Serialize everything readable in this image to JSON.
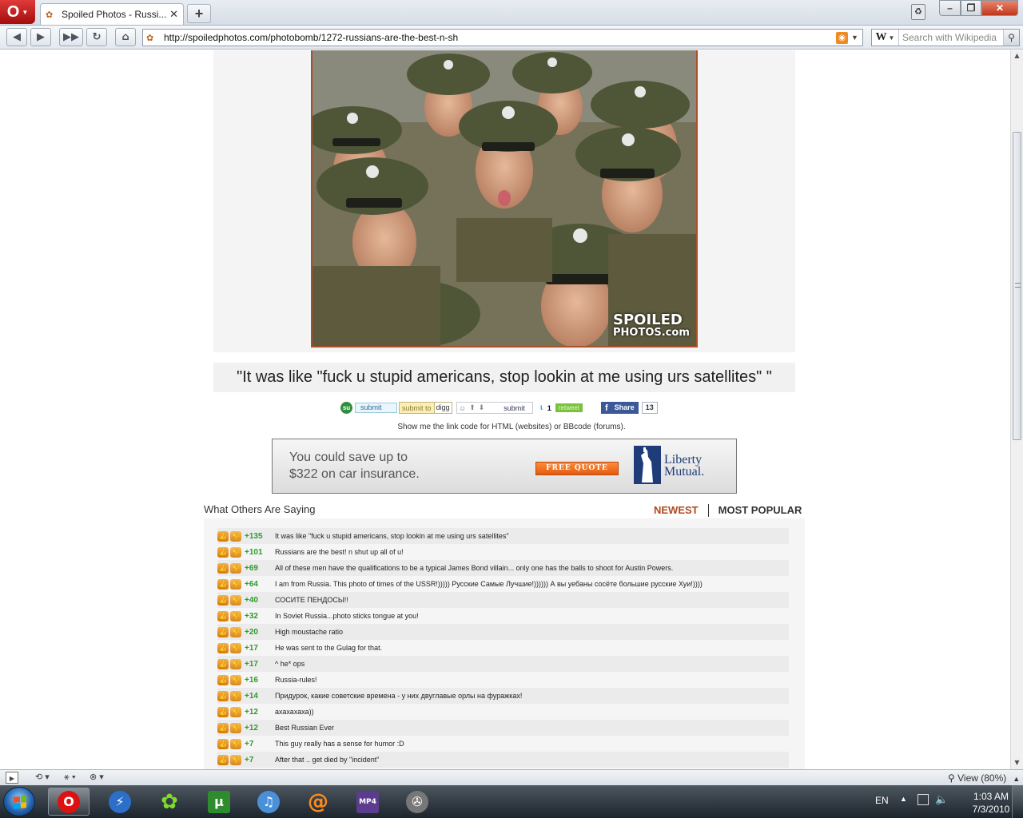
{
  "browser": {
    "tab_title": "Spoiled Photos - Russi...",
    "url": "http://spoiledphotos.com/photobomb/1272-russians-are-the-best-n-sh",
    "search_placeholder": "Search with Wikipedia",
    "search_engine_letter": "W",
    "opera_letter": "O",
    "zoom_label": "View (80%)"
  },
  "photo": {
    "watermark_line1": "SPOILED",
    "watermark_line2": "PHOTOS.com"
  },
  "caption": "\"It was like \"fuck u stupid americans, stop lookin at me using urs satellites\" \"",
  "share": {
    "stumble_label": "submit",
    "digg_a": "submit to",
    "digg_b": "digg",
    "reddit_label": "submit",
    "tweet_count": "1",
    "tweet_label": "retweet",
    "fb_label": "Share",
    "fb_count": "13"
  },
  "linkcode_text": "Show me the link code for HTML (websites) or BBcode (forums).",
  "ad": {
    "line1": "You could save up to",
    "line2": "$322 on car insurance.",
    "cta": "FREE QUOTE",
    "brand_line1": "Liberty",
    "brand_line2": "Mutual."
  },
  "comments": {
    "title": "What Others Are Saying",
    "sort_newest": "NEWEST",
    "sort_popular": "MOST POPULAR",
    "items": [
      {
        "score": "+135",
        "text": "It was like \"fuck u stupid americans, stop lookin at me using urs satellites\""
      },
      {
        "score": "+101",
        "text": "Russians are the best! n shut up all of u!"
      },
      {
        "score": "+69",
        "text": "All of these men have the qualifications to be a typical James Bond villain... only one has the balls to shoot for Austin Powers."
      },
      {
        "score": "+64",
        "text": "I am from Russia. This photo of times of the USSR!))))) Русские Самые Лучшие!)))))) А вы уебаны сосёте большие русские Хуи!))))"
      },
      {
        "score": "+40",
        "text": "СОСИТЕ ПЕНДОСЫ!!"
      },
      {
        "score": "+32",
        "text": "In Soviet Russia...photo sticks tongue at you!"
      },
      {
        "score": "+20",
        "text": "High moustache ratio"
      },
      {
        "score": "+17",
        "text": "He was sent to the Gulag for that."
      },
      {
        "score": "+17",
        "text": "^ he* ops"
      },
      {
        "score": "+16",
        "text": "Russia-rules!"
      },
      {
        "score": "+14",
        "text": "Придурок, какие советские времена - у них двуглавые орлы на фуражках!"
      },
      {
        "score": "+12",
        "text": "ахахахаха))"
      },
      {
        "score": "+12",
        "text": "Best Russian Ever"
      },
      {
        "score": "+7",
        "text": "This guy really has a sense for humor :D"
      },
      {
        "score": "+7",
        "text": "After that .. get died by \"incident\""
      }
    ]
  },
  "taskbar": {
    "lang": "EN",
    "time": "1:03 AM",
    "date": "7/3/2010"
  }
}
